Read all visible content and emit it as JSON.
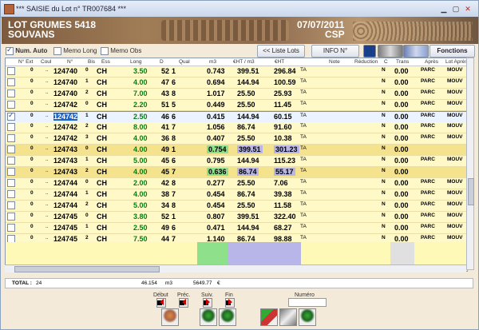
{
  "window": {
    "title": "*** SAISIE du Lot n° TR007684 ***"
  },
  "banner": {
    "title": "LOT GRUMES 5418",
    "place": "SOUVANS",
    "date": "07/07/2011",
    "code": "CSP"
  },
  "options": {
    "num_auto": "Num. Auto",
    "memo_long": "Memo Long",
    "memo_obs": "Memo Obs"
  },
  "toolbar": {
    "liste_lots": "<< Liste Lots",
    "info": "INFO N°",
    "fonctions": "Fonctions"
  },
  "columns": [
    "N° Ext",
    "Coul",
    "N°",
    "Bis",
    "Ess",
    "Long",
    "D",
    "Qual",
    "m3",
    "€HT / m3",
    "€HT",
    "",
    "Note",
    "Réduction",
    "C",
    "Trans",
    "Après",
    "Lot Après"
  ],
  "rows": [
    {
      "ext": "0",
      "coul": "..",
      "num": "124740",
      "bis": "0",
      "ess": "CH",
      "long": "3.50",
      "d": "52",
      "qual": "1",
      "m3": "0.743",
      "ppm": "399.51",
      "ht": "296.84",
      "ta": "TA",
      "c": "N",
      "trans": "0.00",
      "apres": "PARC",
      "lot": "MOUV"
    },
    {
      "ext": "0",
      "coul": "..",
      "num": "124740",
      "bis": "1",
      "ess": "CH",
      "long": "4.00",
      "d": "47",
      "qual": "6",
      "m3": "0.694",
      "ppm": "144.94",
      "ht": "100.59",
      "ta": "TA",
      "c": "N",
      "trans": "0.00",
      "apres": "PARC",
      "lot": "MOUV"
    },
    {
      "ext": "0",
      "coul": "..",
      "num": "124740",
      "bis": "2",
      "ess": "CH",
      "long": "7.00",
      "d": "43",
      "qual": "8",
      "m3": "1.017",
      "ppm": "25.50",
      "ht": "25.93",
      "ta": "TA",
      "c": "N",
      "trans": "0.00",
      "apres": "PARC",
      "lot": "MOUV"
    },
    {
      "ext": "0",
      "coul": "..",
      "num": "124742",
      "bis": "0",
      "ess": "CH",
      "long": "2.20",
      "d": "51",
      "qual": "5",
      "m3": "0.449",
      "ppm": "25.50",
      "ht": "11.45",
      "ta": "TA",
      "c": "N",
      "trans": "0.00",
      "apres": "PARC",
      "lot": "MOUV"
    },
    {
      "ext": "0",
      "coul": "..",
      "num": "124742",
      "bis": "1",
      "ess": "CH",
      "long": "2.50",
      "d": "46",
      "qual": "6",
      "m3": "0.415",
      "ppm": "144.94",
      "ht": "60.15",
      "ta": "TA",
      "c": "N",
      "trans": "0.00",
      "apres": "PARC",
      "lot": "MOUV"
    },
    {
      "ext": "0",
      "coul": "..",
      "num": "124742",
      "bis": "2",
      "ess": "CH",
      "long": "8.00",
      "d": "41",
      "qual": "7",
      "m3": "1.056",
      "ppm": "86.74",
      "ht": "91.60",
      "ta": "TA",
      "c": "N",
      "trans": "0.00",
      "apres": "PARC",
      "lot": "MOUV"
    },
    {
      "ext": "0",
      "coul": "..",
      "num": "124742",
      "bis": "3",
      "ess": "CH",
      "long": "4.00",
      "d": "36",
      "qual": "8",
      "m3": "0.407",
      "ppm": "25.50",
      "ht": "10.38",
      "ta": "TA",
      "c": "N",
      "trans": "0.00",
      "apres": "PARC",
      "lot": "MOUV"
    },
    {
      "ext": "0",
      "coul": "..",
      "num": "124743",
      "bis": "0",
      "ess": "CH",
      "long": "4.00",
      "d": "49",
      "qual": "1",
      "m3": "0.754",
      "ppm": "399.51",
      "ht": "301.23",
      "ta": "TA",
      "c": "N",
      "trans": "0.00",
      "apres": "",
      "lot": ""
    },
    {
      "ext": "0",
      "coul": "..",
      "num": "124743",
      "bis": "1",
      "ess": "CH",
      "long": "5.00",
      "d": "45",
      "qual": "6",
      "m3": "0.795",
      "ppm": "144.94",
      "ht": "115.23",
      "ta": "TA",
      "c": "N",
      "trans": "0.00",
      "apres": "PARC",
      "lot": "MOUV"
    },
    {
      "ext": "0",
      "coul": "..",
      "num": "124743",
      "bis": "2",
      "ess": "CH",
      "long": "4.00",
      "d": "45",
      "qual": "7",
      "m3": "0.636",
      "ppm": "86.74",
      "ht": "55.17",
      "ta": "TA",
      "c": "N",
      "trans": "0.00",
      "apres": "",
      "lot": ""
    },
    {
      "ext": "0",
      "coul": "..",
      "num": "124744",
      "bis": "0",
      "ess": "CH",
      "long": "2.00",
      "d": "42",
      "qual": "8",
      "m3": "0.277",
      "ppm": "25.50",
      "ht": "7.06",
      "ta": "TA",
      "c": "N",
      "trans": "0.00",
      "apres": "PARC",
      "lot": "MOUV"
    },
    {
      "ext": "0",
      "coul": "..",
      "num": "124744",
      "bis": "1",
      "ess": "CH",
      "long": "4.00",
      "d": "38",
      "qual": "7",
      "m3": "0.454",
      "ppm": "86.74",
      "ht": "39.38",
      "ta": "TA",
      "c": "N",
      "trans": "0.00",
      "apres": "PARC",
      "lot": "MOUV"
    },
    {
      "ext": "0",
      "coul": "..",
      "num": "124744",
      "bis": "2",
      "ess": "CH",
      "long": "5.00",
      "d": "34",
      "qual": "8",
      "m3": "0.454",
      "ppm": "25.50",
      "ht": "11.58",
      "ta": "TA",
      "c": "N",
      "trans": "0.00",
      "apres": "PARC",
      "lot": "MOUV"
    },
    {
      "ext": "0",
      "coul": "..",
      "num": "124745",
      "bis": "0",
      "ess": "CH",
      "long": "3.80",
      "d": "52",
      "qual": "1",
      "m3": "0.807",
      "ppm": "399.51",
      "ht": "322.40",
      "ta": "TA",
      "c": "N",
      "trans": "0.00",
      "apres": "PARC",
      "lot": "MOUV"
    },
    {
      "ext": "0",
      "coul": "..",
      "num": "124745",
      "bis": "1",
      "ess": "CH",
      "long": "2.50",
      "d": "49",
      "qual": "6",
      "m3": "0.471",
      "ppm": "144.94",
      "ht": "68.27",
      "ta": "TA",
      "c": "N",
      "trans": "0.00",
      "apres": "PARC",
      "lot": "MOUV"
    },
    {
      "ext": "0",
      "coul": "..",
      "num": "124745",
      "bis": "2",
      "ess": "CH",
      "long": "7.50",
      "d": "44",
      "qual": "7",
      "m3": "1.140",
      "ppm": "86.74",
      "ht": "98.88",
      "ta": "TA",
      "c": "N",
      "trans": "0.00",
      "apres": "PARC",
      "lot": "MOUV"
    }
  ],
  "total": {
    "label": "TOTAL :",
    "count": "24",
    "m3": "46.154",
    "m3_unit": "m3",
    "ht": "5649.77",
    "currency": "€"
  },
  "nav": {
    "debut": "Début",
    "prec": "Préc.",
    "suiv": "Suiv.",
    "fin": "Fin",
    "numero": "Numéro"
  }
}
